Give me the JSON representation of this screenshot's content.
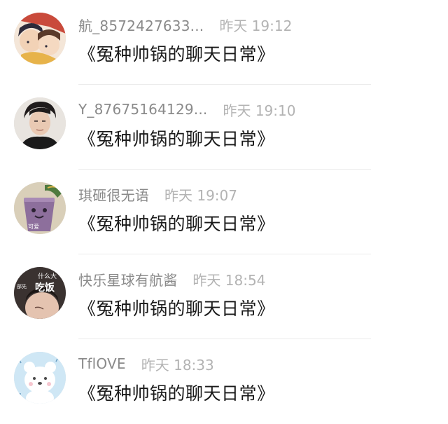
{
  "comments": [
    {
      "username": "航_8572427633...",
      "time": "昨天 19:12",
      "text": "《冤种帅锅的聊天日常》",
      "avatar_icon": "anime-couple-avatar-icon",
      "avatar_colors": [
        "#c94a3b",
        "#f2d2b6",
        "#2d2a3a"
      ]
    },
    {
      "username": "Y_87675164129...",
      "time": "昨天 19:10",
      "text": "《冤种帅锅的聊天日常》",
      "avatar_icon": "man-portrait-avatar-icon",
      "avatar_colors": [
        "#e8e4df",
        "#1f1b1b",
        "#e9c9b3"
      ]
    },
    {
      "username": "琪砸很无语",
      "time": "昨天 19:07",
      "text": "《冤种帅锅的聊天日常》",
      "avatar_icon": "purple-cup-avatar-icon",
      "avatar_colors": [
        "#d9cfb9",
        "#8d6f9c",
        "#4e7a3f"
      ],
      "avatar_caption": "可爱"
    },
    {
      "username": "快乐星球有航酱",
      "time": "昨天 18:54",
      "text": "《冤种帅锅的聊天日常》",
      "avatar_icon": "meme-boy-avatar-icon",
      "avatar_colors": [
        "#3a3230",
        "#e4c3b0",
        "#ffffff"
      ],
      "avatar_caption_top": "什么大",
      "avatar_caption_left": "部先",
      "avatar_caption_main": "吃饭"
    },
    {
      "username": "TflOVE",
      "time": "昨天 18:33",
      "text": "《冤种帅锅的聊天日常》",
      "avatar_icon": "white-bear-avatar-icon",
      "avatar_colors": [
        "#cfe7f5",
        "#ffffff",
        "#6b9ec2"
      ]
    }
  ]
}
